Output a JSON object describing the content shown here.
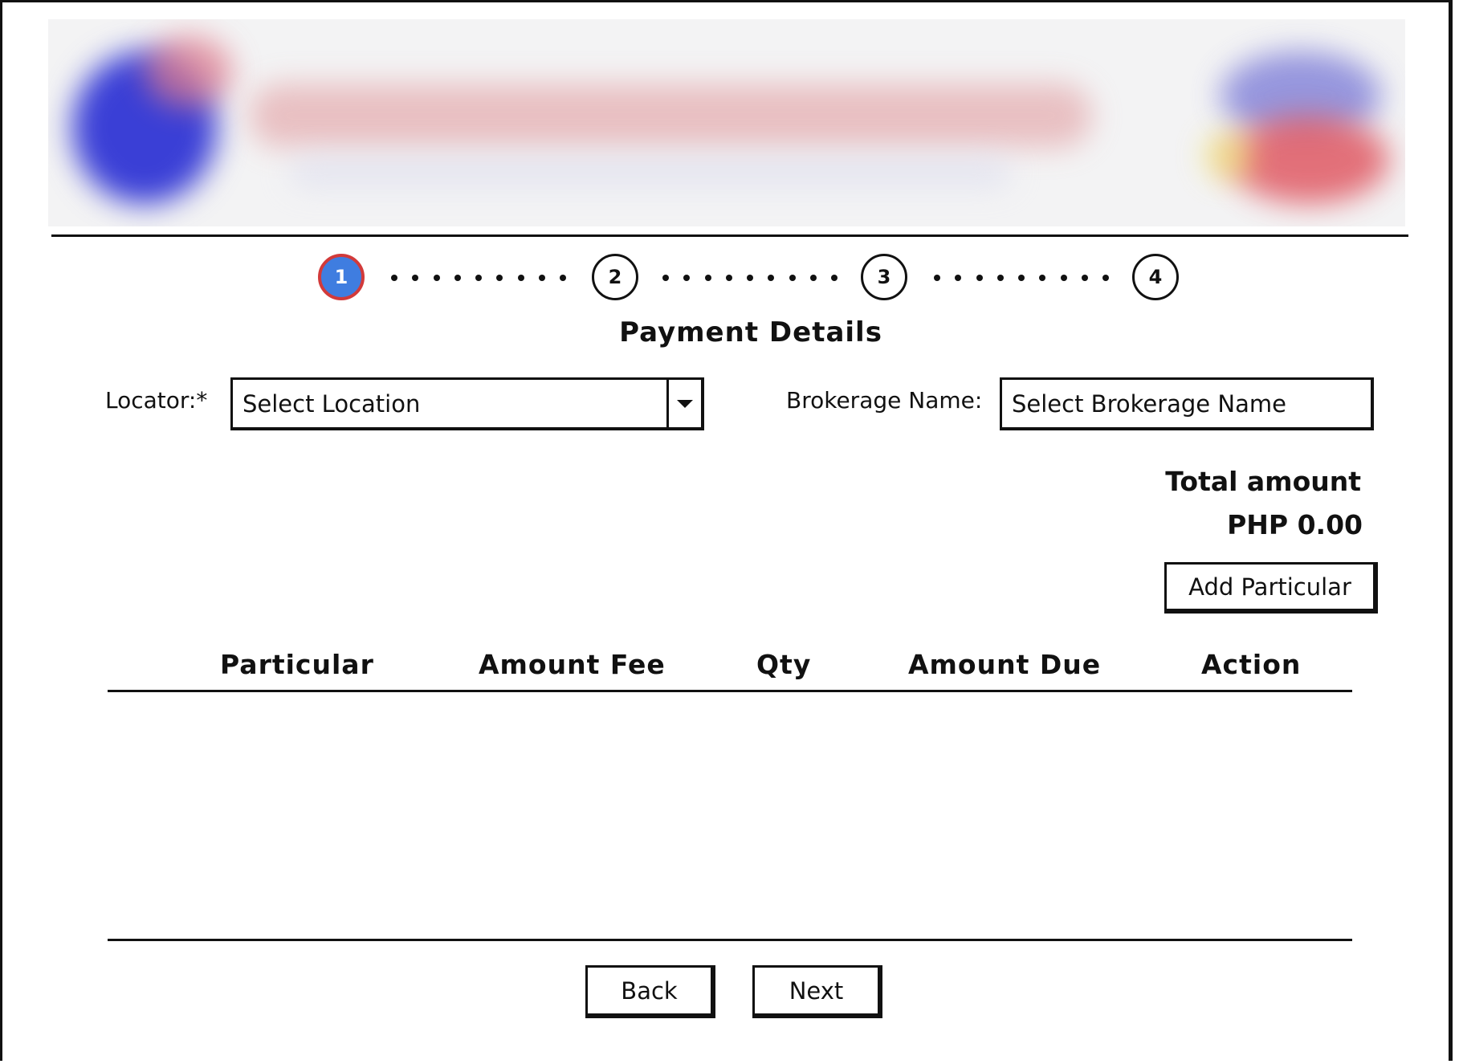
{
  "stepper": {
    "steps": [
      "1",
      "2",
      "3",
      "4"
    ],
    "active_step": "1",
    "active_color": "#3f7de0",
    "active_border_color": "#d23a3a"
  },
  "page_title": "Payment Details",
  "locator": {
    "label": "Locator:*",
    "placeholder": "Select Location"
  },
  "brokerage": {
    "label": "Brokerage Name:",
    "placeholder": "Select Brokerage Name"
  },
  "total": {
    "label": "Total amount",
    "value": "PHP 0.00"
  },
  "add_particular_label": "Add Particular",
  "table": {
    "columns": [
      "Particular",
      "Amount Fee",
      "Qty",
      "Amount Due",
      "Action"
    ],
    "rows": []
  },
  "footer": {
    "back_label": "Back",
    "next_label": "Next"
  }
}
